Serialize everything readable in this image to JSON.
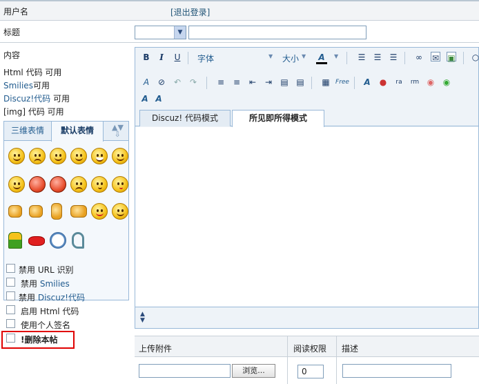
{
  "form": {
    "username_label": "用户名",
    "logout_link": "[退出登录]",
    "title_label": "标题",
    "content_label": "内容",
    "html_code": "Html 代码",
    "html_status": "可用",
    "smilies_link": "Smilies",
    "smilies_status": "可用",
    "discuz_link": "Discuz!代码",
    "discuz_status": "可用",
    "img_code": "[img] 代码",
    "img_status": "可用"
  },
  "smilies": {
    "tab_3d": "三维表情",
    "tab_default": "默认表情",
    "icons": [
      "smile-icon",
      "sad-icon",
      "happy-icon",
      "shy-icon",
      "grin-icon",
      "wink-icon",
      "laugh-icon",
      "angry-icon",
      "mad-icon",
      "cry-icon",
      "think-icon",
      "kiss-icon",
      "point-left-icon",
      "point-right-icon",
      "victory-icon",
      "handshake-icon",
      "tongue-icon",
      "smile2-icon",
      "man-icon",
      "lips-icon",
      "clock-icon",
      "phone-icon"
    ]
  },
  "options": [
    {
      "prefix": "禁用",
      "label": "URL 识别",
      "link": false
    },
    {
      "prefix": "禁用",
      "label": "Smilies",
      "link": true
    },
    {
      "prefix": "禁用",
      "label": "Discuz!代码",
      "link": true
    },
    {
      "prefix": "启用",
      "label": "Html 代码",
      "link": false
    },
    {
      "prefix": "",
      "label": "使用个人签名",
      "link": false
    },
    {
      "prefix": "",
      "label": "!删除本帖",
      "link": false
    }
  ],
  "editor": {
    "font_label": "字体",
    "size_label": "大小",
    "mode_code": "Discuz! 代码模式",
    "mode_wysiwyg": "所见即所得模式"
  },
  "attachments": {
    "upload_header": "上传附件",
    "permission_header": "阅读权限",
    "description_header": "描述",
    "browse_button": "浏览...",
    "permission_value": "0"
  },
  "colors": {
    "link": "#225c8f",
    "highlight_border": "#e00000",
    "panel_border": "#98b8d8"
  }
}
